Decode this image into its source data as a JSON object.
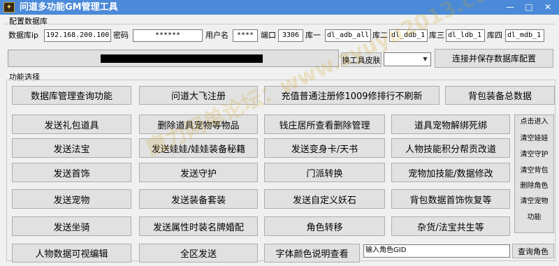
{
  "window": {
    "title": "问道多功能GM管理工具",
    "controls": {
      "minimize": "—",
      "maximize": "□",
      "close": "✕"
    }
  },
  "db_config": {
    "group_title": "配置数据库",
    "ip_label": "数据库ip",
    "ip_value": "192.168.200.100",
    "password_label": "密码",
    "password_value": "******",
    "username_label": "用户名",
    "username_value": "****",
    "port_label": "端口",
    "port_value": "3306",
    "db1_label": "库一",
    "db1_value": "dl_adb_all",
    "db2_label": "库二",
    "db2_value": "dl_ddb_1",
    "db3_label": "库三",
    "db3_value": "dl_ldb_1",
    "db4_label": "库四",
    "db4_value": "dl_mdb_1",
    "skin_button": "换工具皮肤",
    "skin_select_value": "",
    "connect_button": "连接并保存数据库配置"
  },
  "functions": {
    "group_title": "功能选择",
    "buttons": [
      "数据库管理查询功能",
      "问道大飞注册",
      "充值普通注册修1009修排行不刷新",
      "背包装备总数据",
      "发送礼包道具",
      "删除道具宠物等物品",
      "钱庄居所查看删除管理",
      "道具宠物解绑死绑",
      "发送法宝",
      "发送娃娃/娃娃装备秘籍",
      "发送变身卡/天书",
      "人物技能积分帮贡改道",
      "发送首饰",
      "发送守护",
      "门派转换",
      "宠物加技能/数据修改",
      "发送宠物",
      "发送装备套装",
      "发送自定义妖石",
      "背包数据首饰恢复等",
      "发送坐骑",
      "发送属性时装名牌婚配",
      "角色转移",
      "杂货/法宝共生等",
      "人物数据可视编辑",
      "全区发送",
      "字体颜色说明查看"
    ],
    "role_gid_value": "输入角色GID",
    "query_role_button": "查询角色",
    "side_panel": [
      "点击进入",
      "清空娃娃",
      "清空守护",
      "清空背包",
      "删除角色",
      "清空宠物",
      "功能"
    ]
  },
  "watermark": "魔力网单论坛：www.zyuyu2013.com"
}
